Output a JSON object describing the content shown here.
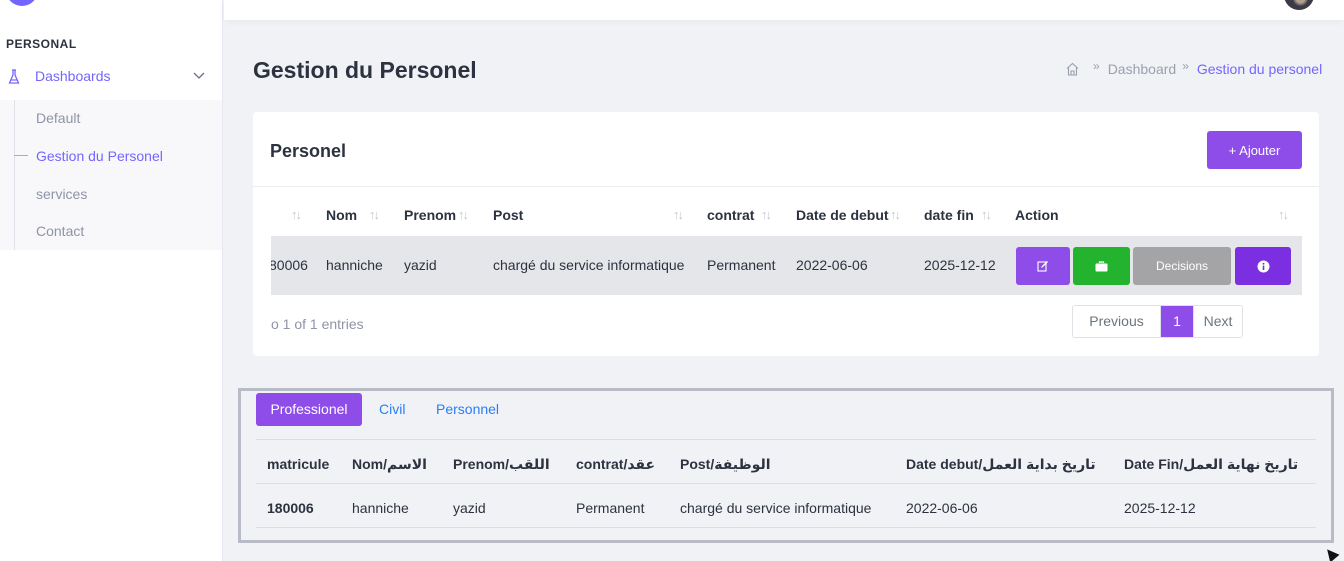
{
  "sidebar": {
    "section_label": "PERSONAL",
    "dashboards_label": "Dashboards",
    "items": [
      {
        "label": "Default"
      },
      {
        "label": "Gestion du Personel"
      },
      {
        "label": "services"
      },
      {
        "label": "Contact"
      }
    ]
  },
  "header": {
    "page_title": "Gestion du Personel",
    "breadcrumb": [
      "Dashboard",
      "Gestion du personel"
    ]
  },
  "card": {
    "title": "Personel",
    "add_button": "+ Ajouter",
    "columns": [
      "Nom",
      "Prenom",
      "Post",
      "contrat",
      "Date de debut",
      "date fin",
      "Action"
    ],
    "row": {
      "matricule": "80006",
      "nom": "hanniche",
      "prenom": "yazid",
      "post": "chargé du service informatique",
      "contrat": "Permanent",
      "date_debut": "2022-06-06",
      "date_fin": "2025-12-12",
      "decisions_label": "Decisions"
    },
    "entries_text": "o 1 of 1 entries",
    "pagination": {
      "previous": "Previous",
      "page": "1",
      "next": "Next"
    }
  },
  "details": {
    "tabs": [
      "Professionel",
      "Civil",
      "Personnel"
    ],
    "columns": [
      "matricule",
      "Nom/الاسم",
      "Prenom/اللقب",
      "contrat/عقد",
      "Post/الوظيفة",
      "Date debut/تاريخ بداية العمل",
      "Date Fin/تاريخ نهاية العمل"
    ],
    "row": [
      "180006",
      "hanniche",
      "yazid",
      "Permanent",
      "chargé du service informatique",
      "2022-06-06",
      "2025-12-12"
    ]
  },
  "colors": {
    "accent": "#8e4de8",
    "primary": "#7366ff",
    "success": "#24b32f",
    "link": "#2a7ef5"
  }
}
